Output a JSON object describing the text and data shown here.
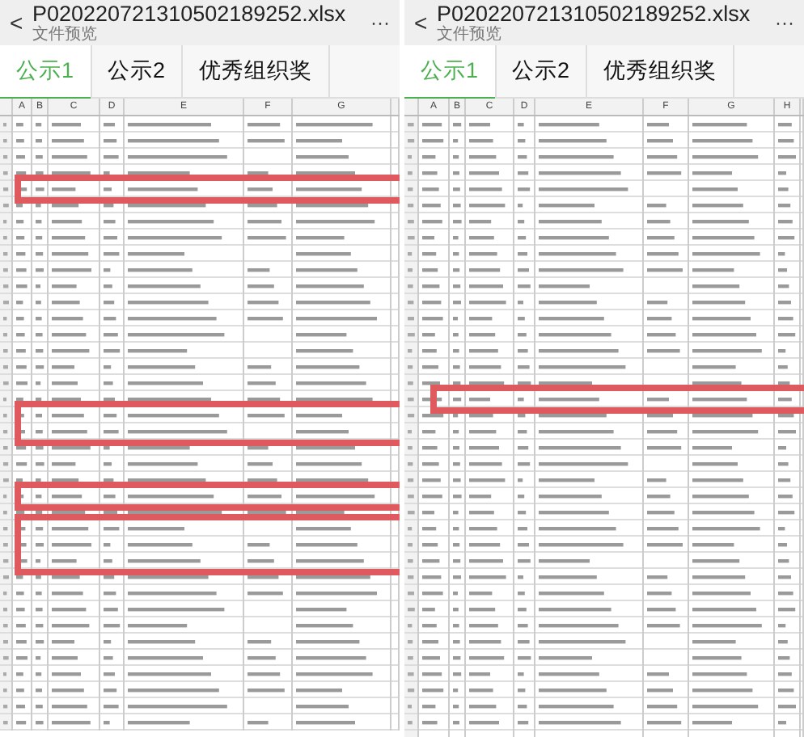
{
  "panels": [
    {
      "title": "P020220721310502189252.xlsx",
      "subtitle": "文件预览",
      "menu": "···",
      "back": "<",
      "tabs": [
        {
          "label": "公示1",
          "selected": true
        },
        {
          "label": "公示2",
          "selected": false
        },
        {
          "label": "优秀组织奖",
          "selected": false
        }
      ],
      "columns": [
        "A",
        "B",
        "C",
        "D",
        "E",
        "F",
        "G"
      ],
      "rows": [
        {
          "highlighted": false
        },
        {
          "highlighted": false
        },
        {
          "highlighted": false
        },
        {
          "highlighted": false
        },
        {
          "highlighted": true
        },
        {
          "highlighted": false
        },
        {
          "highlighted": false
        },
        {
          "highlighted": false
        },
        {
          "highlighted": false
        },
        {
          "highlighted": false
        },
        {
          "highlighted": false
        },
        {
          "highlighted": false
        },
        {
          "highlighted": false
        },
        {
          "highlighted": false
        },
        {
          "highlighted": false
        },
        {
          "highlighted": false
        },
        {
          "highlighted": false
        },
        {
          "highlighted": false
        },
        {
          "highlighted": true
        },
        {
          "highlighted": true
        },
        {
          "highlighted": false
        },
        {
          "highlighted": false
        },
        {
          "highlighted": false
        },
        {
          "highlighted": true
        },
        {
          "highlighted": false
        },
        {
          "highlighted": true
        },
        {
          "highlighted": true
        },
        {
          "highlighted": true
        },
        {
          "highlighted": false
        },
        {
          "highlighted": false
        },
        {
          "highlighted": false
        },
        {
          "highlighted": false
        },
        {
          "highlighted": false
        },
        {
          "highlighted": false
        },
        {
          "highlighted": false
        },
        {
          "highlighted": false
        },
        {
          "highlighted": false
        },
        {
          "highlighted": false
        }
      ]
    },
    {
      "title": "P020220721310502189252.xlsx",
      "subtitle": "文件预览",
      "menu": "···",
      "back": "<",
      "tabs": [
        {
          "label": "公示1",
          "selected": true
        },
        {
          "label": "公示2",
          "selected": false
        },
        {
          "label": "优秀组织奖",
          "selected": false
        }
      ],
      "columns": [
        "A",
        "B",
        "C",
        "D",
        "E",
        "F",
        "G",
        "H"
      ],
      "rows": [
        {
          "highlighted": false
        },
        {
          "highlighted": false
        },
        {
          "highlighted": false
        },
        {
          "highlighted": false
        },
        {
          "highlighted": false
        },
        {
          "highlighted": false
        },
        {
          "highlighted": false
        },
        {
          "highlighted": false
        },
        {
          "highlighted": false
        },
        {
          "highlighted": false
        },
        {
          "highlighted": false
        },
        {
          "highlighted": false
        },
        {
          "highlighted": false
        },
        {
          "highlighted": false
        },
        {
          "highlighted": false
        },
        {
          "highlighted": false
        },
        {
          "highlighted": false
        },
        {
          "highlighted": true
        },
        {
          "highlighted": false
        },
        {
          "highlighted": false
        },
        {
          "highlighted": false
        },
        {
          "highlighted": false
        },
        {
          "highlighted": false
        },
        {
          "highlighted": false
        },
        {
          "highlighted": false
        },
        {
          "highlighted": false
        },
        {
          "highlighted": false
        },
        {
          "highlighted": false
        },
        {
          "highlighted": false
        },
        {
          "highlighted": false
        },
        {
          "highlighted": false
        },
        {
          "highlighted": false
        },
        {
          "highlighted": false
        },
        {
          "highlighted": false
        },
        {
          "highlighted": false
        },
        {
          "highlighted": false
        },
        {
          "highlighted": false
        },
        {
          "highlighted": false
        },
        {
          "highlighted": false
        }
      ]
    }
  ]
}
